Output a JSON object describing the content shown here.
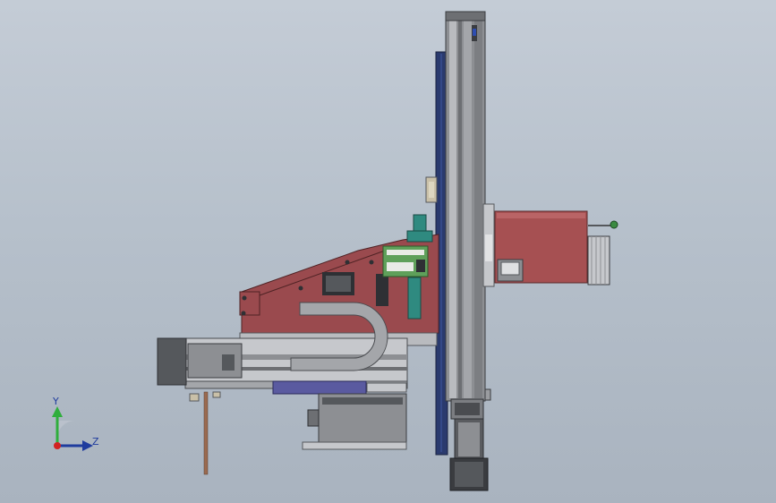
{
  "viewport": {
    "background_top": "#c4ccd6",
    "background_bottom": "#a9b3bf"
  },
  "triad": {
    "y_label": "Y",
    "z_label": "Z",
    "y_color": "#2fae3c",
    "z_color": "#1f3c9e",
    "x_color": "#d22222"
  },
  "colors": {
    "frame_red": "#9a4a4e",
    "motor_red": "#a65052",
    "rail_gray": "#8d8f93",
    "steel_light": "#c6c8cc",
    "dark_gray": "#55585c",
    "navy_plate": "#2a3a6e",
    "purple_plate": "#5a5aa0",
    "teal_part": "#2f8a80",
    "pcb_green": "#5fa05a",
    "copper_rod": "#9a6a50"
  }
}
